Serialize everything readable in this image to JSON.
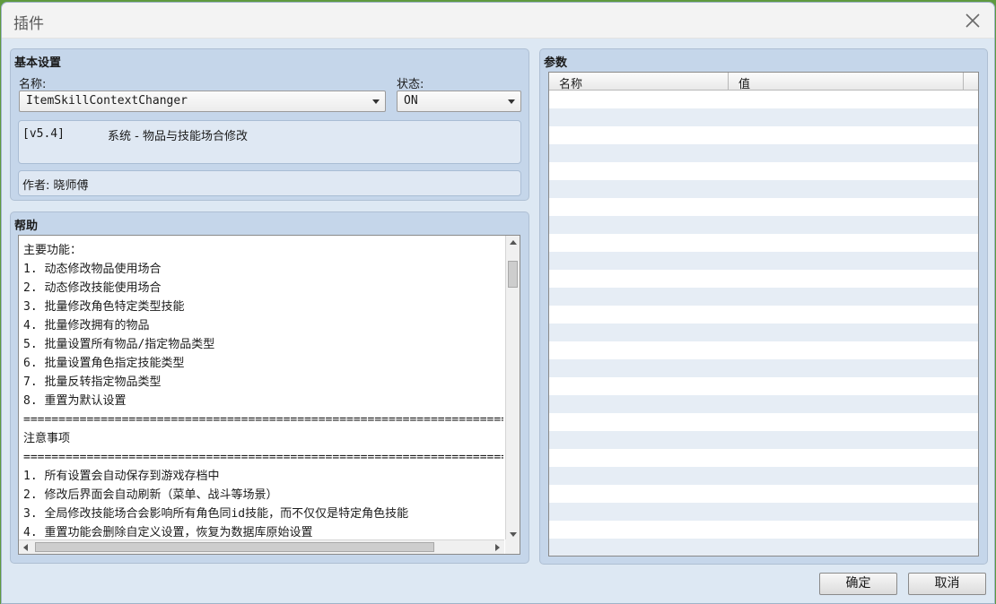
{
  "window": {
    "title": "插件"
  },
  "basic_settings": {
    "title": "基本设置",
    "name_label": "名称:",
    "name_value": "ItemSkillContextChanger",
    "status_label": "状态:",
    "status_value": "ON",
    "version": "[v5.4]",
    "description": "系统 - 物品与技能场合修改",
    "author": "作者: 晓师傅"
  },
  "help": {
    "title": "帮助",
    "lines": [
      "主要功能：",
      "1. 动态修改物品使用场合",
      "2. 动态修改技能使用场合",
      "3. 批量修改角色特定类型技能",
      "4. 批量修改拥有的物品",
      "5. 批量设置所有物品/指定物品类型",
      "6. 批量设置角色指定技能类型",
      "7. 批量反转指定物品类型",
      "8. 重置为默认设置",
      "==========================================================================",
      "注意事项",
      "==========================================================================",
      "1. 所有设置会自动保存到游戏存档中",
      "2. 修改后界面会自动刷新（菜单、战斗等场景）",
      "3. 全局修改技能场合会影响所有角色同id技能，而不仅仅是特定角色技能",
      "4. 重置功能会删除自定义设置，恢复为数据库原始设置"
    ]
  },
  "params": {
    "title": "参数",
    "col_name": "名称",
    "col_value": "值"
  },
  "footer": {
    "ok_label": "确定",
    "cancel_label": "取消"
  },
  "icons": {
    "close": "close-icon",
    "dropdown": "chevron-down-icon",
    "scroll_up": "scroll-up-arrow-icon",
    "scroll_down": "scroll-down-arrow-icon",
    "scroll_left": "scroll-left-arrow-icon",
    "scroll_right": "scroll-right-arrow-icon"
  },
  "colors": {
    "panel_bg": "#c5d6ea",
    "window_bg": "#dde8f3",
    "row_alt": "#e6edf5"
  }
}
